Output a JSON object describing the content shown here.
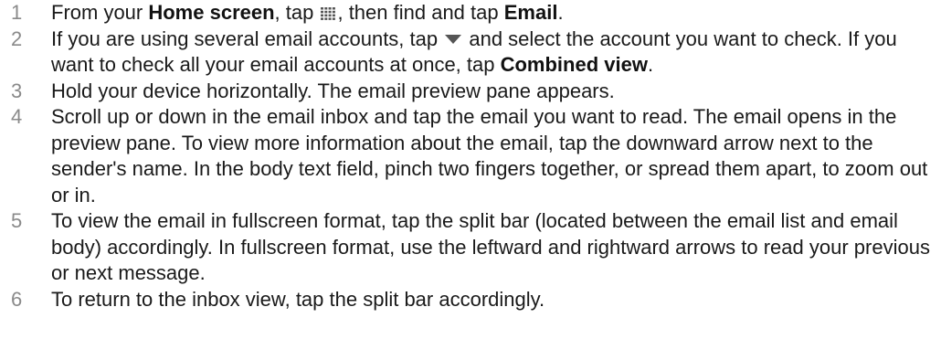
{
  "steps": [
    {
      "num": "1",
      "t1": "From your ",
      "b1": "Home screen",
      "t2": ", tap ",
      "icon": "apps-grid-icon",
      "t3": ", then find and tap ",
      "b2": "Email",
      "t4": "."
    },
    {
      "num": "2",
      "t1": "If you are using several email accounts, tap ",
      "icon": "dropdown-triangle-icon",
      "t2": " and select the account you want to check. If you want to check all your email accounts at once, tap ",
      "b1": "Combined view",
      "t3": "."
    },
    {
      "num": "3",
      "text": "Hold your device horizontally. The email preview pane appears."
    },
    {
      "num": "4",
      "text": "Scroll up or down in the email inbox and tap the email you want to read. The email opens in the preview pane. To view more information about the email, tap the downward arrow next to the sender's name. In the body text field, pinch two fingers together, or spread them apart, to zoom out or in."
    },
    {
      "num": "5",
      "text": "To view the email in fullscreen format, tap the split bar (located between the email list and email body) accordingly. In fullscreen format, use the leftward and rightward arrows to read your previous or next message."
    },
    {
      "num": "6",
      "text": "To return to the inbox view, tap the split bar accordingly."
    }
  ],
  "colors": {
    "text": "#1a1a1a",
    "step_number": "#8a8a8a",
    "icon": "#555555"
  }
}
